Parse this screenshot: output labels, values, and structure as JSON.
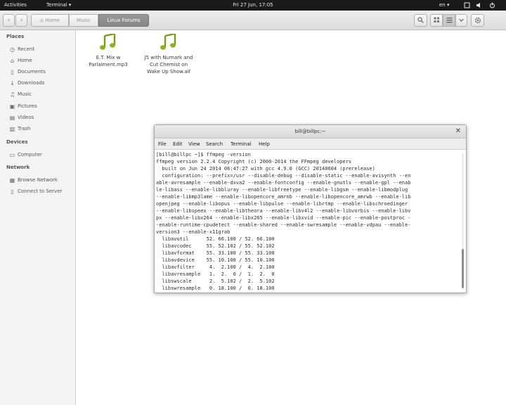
{
  "topbar": {
    "activities": "Activities",
    "app_menu": "Terminal ▾",
    "clock": "Fri 27 Jun, 17:05",
    "language": "en ▾",
    "tray_icons": [
      "window-icon",
      "volume-icon",
      "power-icon"
    ]
  },
  "nautilus": {
    "nav": {
      "back": "‹",
      "forward": "›"
    },
    "breadcrumbs": [
      "Home",
      "Music",
      "Linux Forums"
    ],
    "toolbar_icons": [
      "search-icon",
      "grid-view-icon",
      "list-view-icon",
      "view-options-icon",
      "gear-icon"
    ],
    "sidebar": {
      "sections": [
        {
          "title": "Places",
          "items": [
            {
              "label": "Recent",
              "icon": "clock-icon"
            },
            {
              "label": "Home",
              "icon": "home-icon"
            },
            {
              "label": "Documents",
              "icon": "document-icon"
            },
            {
              "label": "Downloads",
              "icon": "download-icon"
            },
            {
              "label": "Music",
              "icon": "music-icon"
            },
            {
              "label": "Pictures",
              "icon": "picture-icon"
            },
            {
              "label": "Videos",
              "icon": "video-icon"
            },
            {
              "label": "Trash",
              "icon": "trash-icon"
            }
          ]
        },
        {
          "title": "Devices",
          "items": [
            {
              "label": "Computer",
              "icon": "computer-icon"
            }
          ]
        },
        {
          "title": "Network",
          "items": [
            {
              "label": "Browse Network",
              "icon": "network-icon"
            },
            {
              "label": "Connect to Server",
              "icon": "server-icon"
            }
          ]
        }
      ]
    },
    "files": [
      {
        "name_lines": [
          "E.T. Mix w",
          "Parlaiment.mp3"
        ],
        "icon": "audio-file-icon"
      },
      {
        "name_lines": [
          "J5 with Numark and",
          "Cut Chemist on",
          "Wake Up Show.aif"
        ],
        "icon": "audio-file-icon"
      }
    ],
    "colors": {
      "audio_icon": "#7a9a1e",
      "active_crumb": "#8f8f8f"
    }
  },
  "terminal": {
    "title": "bill@billpc:~",
    "menu": [
      "File",
      "Edit",
      "View",
      "Search",
      "Terminal",
      "Help"
    ],
    "lines": [
      "[bill@billpc ~]$ ffmpeg -version",
      "ffmpeg version 2.2.4 Copyright (c) 2000-2014 the FFmpeg developers",
      "  built on Jun 24 2014 06:47:27 with gcc 4.9.0 (GCC) 20140604 (prerelease)",
      "  configuration: --prefix=/usr --disable-debug --disable-static --enable-avisynth --en",
      "able-avresample --enable-dxva2 --enable-fontconfig --enable-gnutls --enable-gpl --enab",
      "le-libass --enable-libbluray --enable-libfreetype --enable-libgsm --enable-libmodplug",
      "--enable-libmp3lame --enable-libopencore_amrnb --enable-libopencore_amrwb --enable-lib",
      "openjpeg --enable-libopus --enable-libpulse --enable-librtmp --enable-libschroedinger",
      "--enable-libspeex --enable-libtheora --enable-libv4l2 --enable-libvorbis --enable-libv",
      "px --enable-libx264 --enable-libx265 --enable-libxvid --enable-pic --enable-postproc -",
      "-enable-runtime-cpudetect --enable-shared --enable-swresample --enable-vdpau --enable-",
      "version3 --enable-x11grab",
      "  libavutil      52. 66.100 / 52. 66.100",
      "  libavcodec     55. 52.102 / 55. 52.102",
      "  libavformat    55. 33.100 / 55. 33.100",
      "  libavdevice    55. 10.100 / 55. 10.100",
      "  libavfilter     4.  2.100 /  4.  2.100",
      "  libavresample   1.  2.  0 /  1.  2.  0",
      "  libswscale      2.  5.102 /  2.  5.102",
      "  libswresample   0. 18.100 /  0. 18.100"
    ],
    "close": "✕"
  }
}
